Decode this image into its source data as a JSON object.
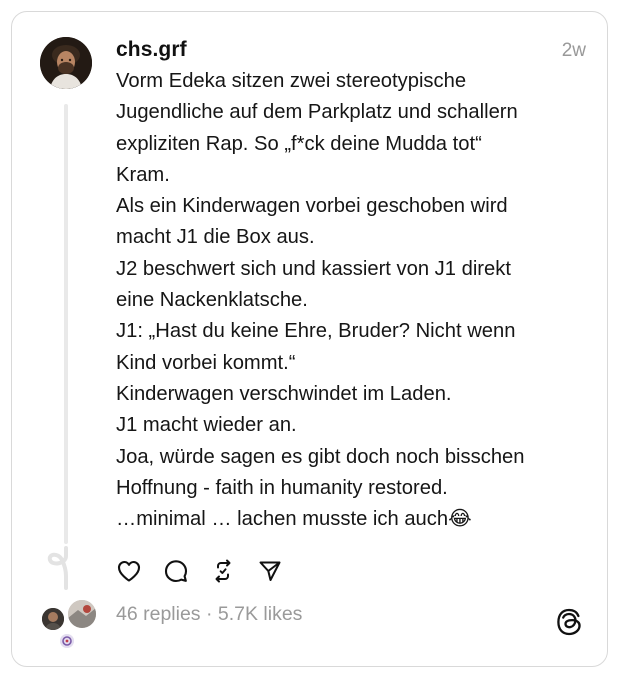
{
  "post": {
    "username": "chs.grf",
    "timestamp": "2w",
    "body_lines": [
      "Vorm Edeka sitzen zwei stereotypische",
      "Jugendliche auf dem Parkplatz und schallern",
      "expliziten Rap. So „f*ck deine Mudda tot“",
      "Kram.",
      "Als ein Kinderwagen vorbei geschoben wird",
      "macht J1 die Box aus.",
      "J2 beschwert sich und kassiert von J1 direkt",
      "eine Nackenklatsche.",
      "J1: „Hast du keine Ehre, Bruder? Nicht wenn",
      "Kind vorbei kommt.“",
      "Kinderwagen verschwindet im Laden.",
      "J1 macht wieder an.",
      "Joa, würde sagen es gibt doch noch bisschen",
      "Hoffnung - faith in humanity restored.",
      "…minimal … lachen musste ich auch😂"
    ]
  },
  "actions": {
    "like_icon": "heart-icon",
    "reply_icon": "comment-icon",
    "repost_icon": "repost-icon",
    "share_icon": "send-icon"
  },
  "footer": {
    "stats": "46 replies · 5.7K likes",
    "app_logo": "threads-logo-icon"
  },
  "colors": {
    "text": "#111111",
    "muted": "#999999",
    "border": "#d9d9d9",
    "thread_line": "#e9e9e9"
  }
}
